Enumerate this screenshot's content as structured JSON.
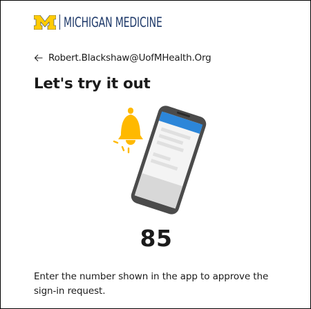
{
  "brand": {
    "logo_text": "MICHIGAN MEDICINE",
    "logo_icon": "block-m-icon",
    "maize_color": "#ffcb05",
    "blue_color": "#1f3a6a"
  },
  "account": {
    "email": "Robert.Blackshaw@UofMHealth.Org",
    "back_icon": "back-arrow-icon"
  },
  "page": {
    "title": "Let's try it out"
  },
  "illustration": {
    "icons": [
      "bell-icon",
      "phone-icon"
    ],
    "bell_color": "#ffb900",
    "phone_header_color": "#2c86d9"
  },
  "challenge": {
    "number": "85",
    "instruction": "Enter the number shown in the app to approve the sign-in request."
  }
}
